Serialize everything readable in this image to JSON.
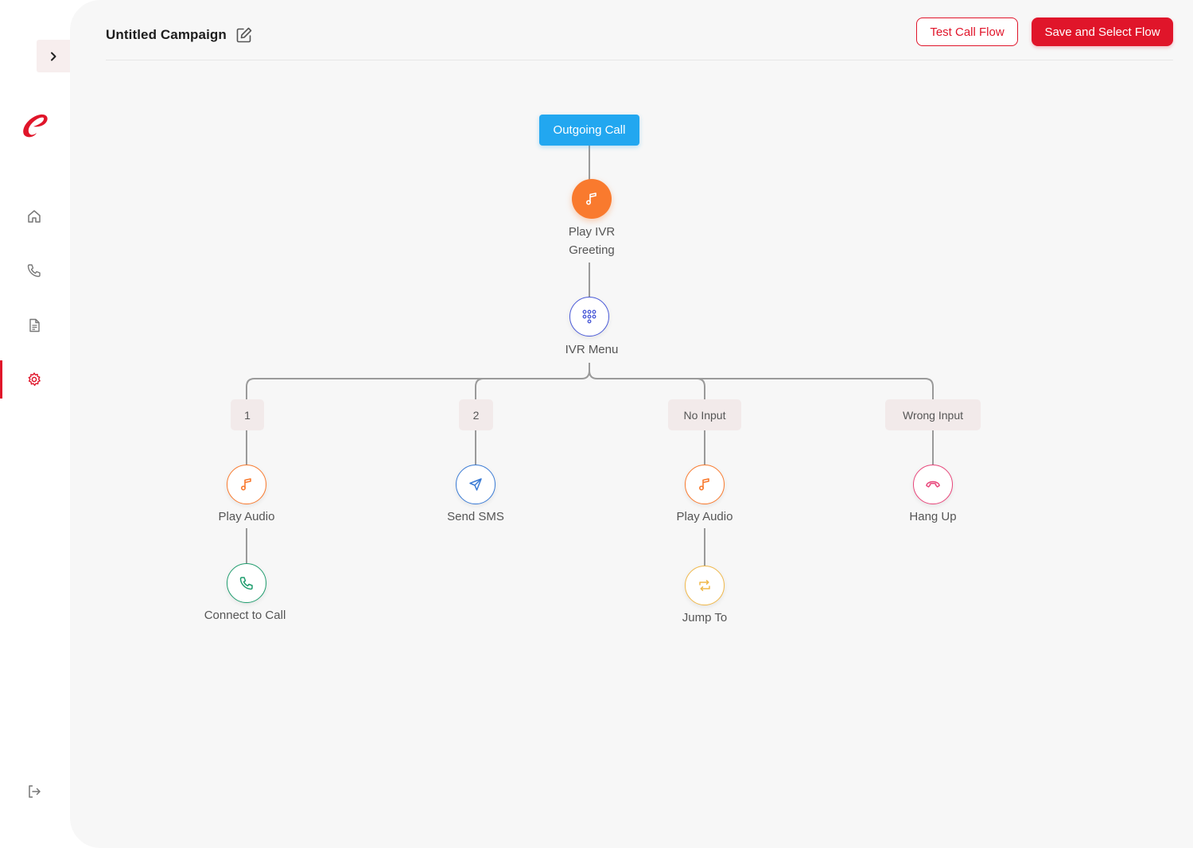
{
  "header": {
    "title": "Untitled Campaign",
    "test_button": "Test Call Flow",
    "save_button": "Save and Select Flow"
  },
  "colors": {
    "brand": "#e0152a",
    "start_node": "#22a7f0",
    "audio": "#f97a2e",
    "ivr_menu": "#4a5ad8",
    "sms": "#3a7bd5",
    "connect": "#1f9d6e",
    "jump": "#f0b84a",
    "hangup": "#e8457a"
  },
  "sidebar": {
    "items": [
      {
        "icon": "home-icon"
      },
      {
        "icon": "phone-icon"
      },
      {
        "icon": "document-icon"
      },
      {
        "icon": "gear-icon",
        "active": true
      }
    ],
    "logout_icon": "logout-icon"
  },
  "flow": {
    "start": "Outgoing Call",
    "greeting": {
      "label": "Play IVR Greeting",
      "icon": "music-note-icon"
    },
    "menu": {
      "label": "IVR Menu",
      "icon": "dialpad-icon"
    },
    "branches": [
      {
        "key": "1",
        "steps": [
          {
            "label": "Play Audio",
            "icon": "music-note-icon"
          },
          {
            "label": "Connect to Call",
            "icon": "phone-icon"
          }
        ]
      },
      {
        "key": "2",
        "steps": [
          {
            "label": "Send SMS",
            "icon": "send-icon"
          }
        ]
      },
      {
        "key": "No Input",
        "steps": [
          {
            "label": "Play Audio",
            "icon": "music-note-icon"
          },
          {
            "label": "Jump To",
            "icon": "repeat-icon"
          }
        ]
      },
      {
        "key": "Wrong Input",
        "steps": [
          {
            "label": "Hang Up",
            "icon": "hang-up-icon"
          }
        ]
      }
    ]
  }
}
